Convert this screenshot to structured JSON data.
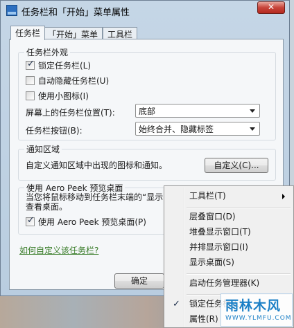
{
  "window": {
    "title": "任务栏和「开始」菜单属性",
    "close_glyph": "✕"
  },
  "tabs": [
    {
      "label": "任务栏",
      "active": true
    },
    {
      "label": "「开始」菜单",
      "active": false
    },
    {
      "label": "工具栏",
      "active": false
    }
  ],
  "appearance": {
    "title": "任务栏外观",
    "checkboxes": [
      {
        "label": "锁定任务栏(L)",
        "checked": true
      },
      {
        "label": "自动隐藏任务栏(U)",
        "checked": false
      },
      {
        "label": "使用小图标(I)",
        "checked": false
      }
    ],
    "location_label": "屏幕上的任务栏位置(T):",
    "location_value": "底部",
    "buttons_label": "任务栏按钮(B):",
    "buttons_value": "始终合并、隐藏标签"
  },
  "notification": {
    "title": "通知区域",
    "description": "自定义通知区域中出现的图标和通知。",
    "customize_button": "自定义(C)..."
  },
  "aero_peek": {
    "title": "使用 Aero Peek 预览桌面",
    "description_line1": "当您将鼠标移动到任务栏末端的“显示",
    "description_line2": "查看桌面。",
    "checkbox_label": "使用 Aero Peek 预览桌面(P)",
    "checked": true
  },
  "help_link": "如何自定义该任务栏?",
  "footer": {
    "ok_button": "确定"
  },
  "context_menu": {
    "items": [
      {
        "label": "工具栏(T)",
        "submenu": true
      },
      {
        "label": "层叠窗口(D)"
      },
      {
        "label": "堆叠显示窗口(T)"
      },
      {
        "label": "并排显示窗口(I)"
      },
      {
        "label": "显示桌面(S)"
      },
      {
        "label": "启动任务管理器(K)"
      },
      {
        "label": "锁定任务栏(L)",
        "checked": true
      },
      {
        "label": "属性(R)"
      }
    ],
    "check_glyph": "✓"
  },
  "watermark": {
    "logo": "雨林木风",
    "url": "WWW.YLMFU.COM"
  }
}
